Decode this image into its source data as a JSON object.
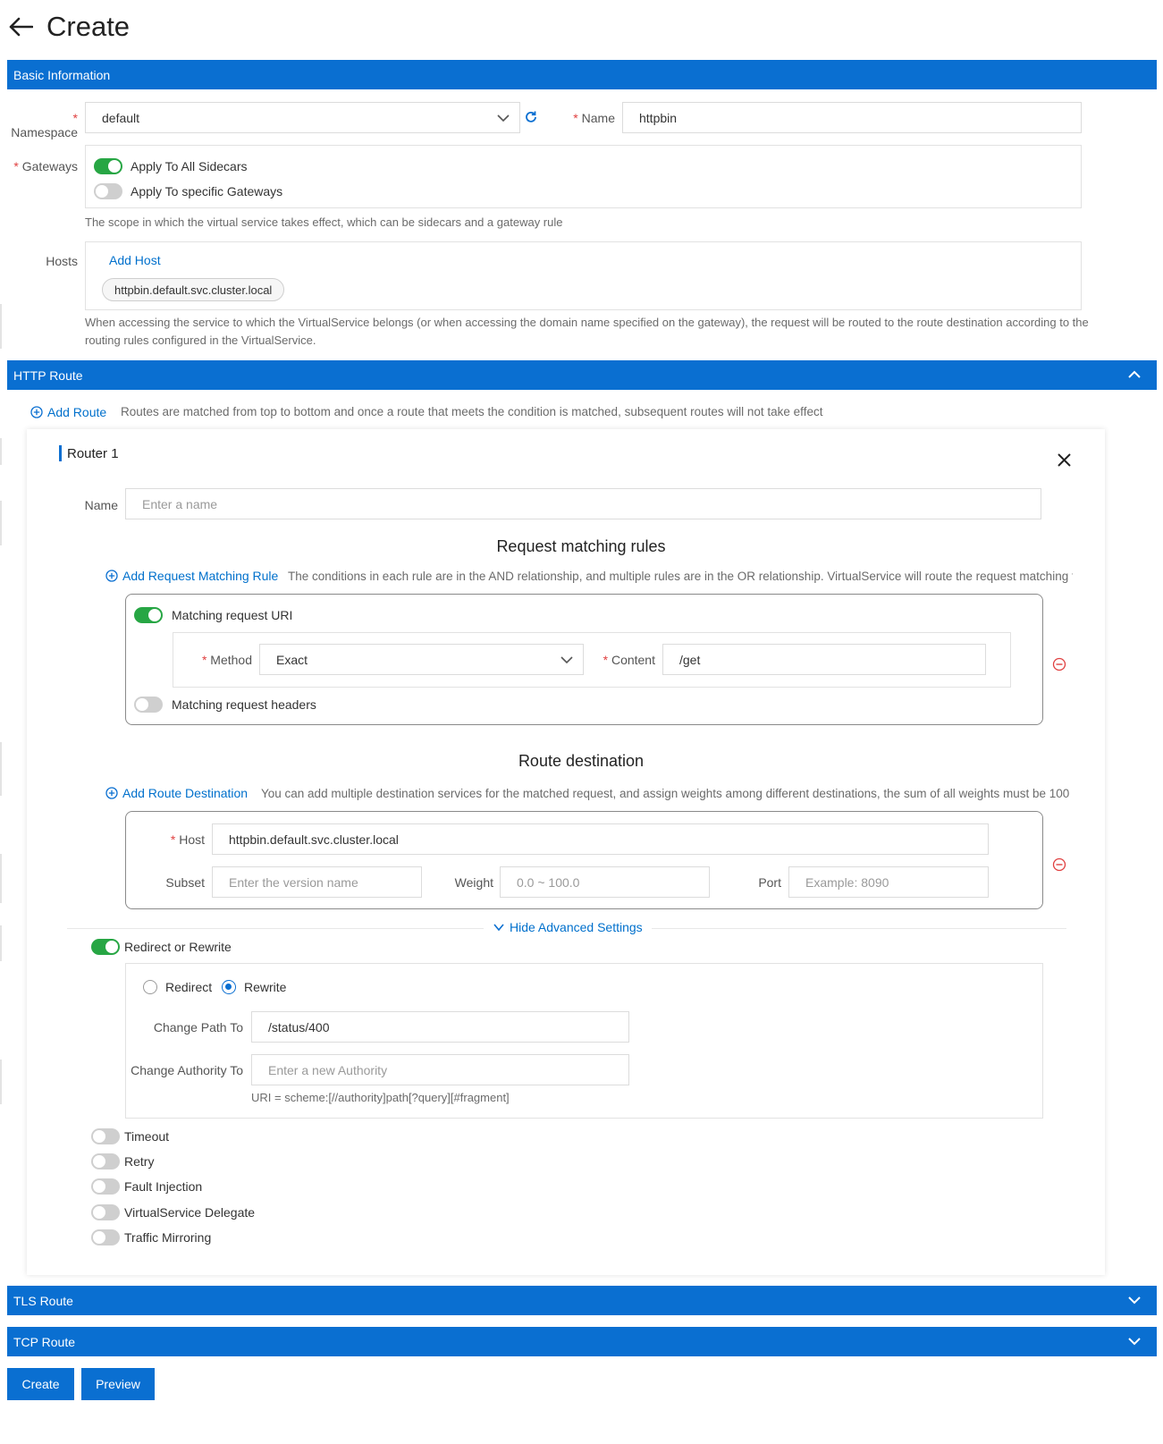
{
  "page": {
    "title": "Create"
  },
  "basic": {
    "section_title": "Basic Information",
    "namespace_label": "Namespace",
    "namespace_value": "default",
    "name_label": "Name",
    "name_value": "httpbin",
    "gateways_label": "Gateways",
    "apply_all_label": "Apply To All Sidecars",
    "apply_all_on": true,
    "apply_specific_label": "Apply To specific Gateways",
    "apply_specific_on": false,
    "gateways_hint": "The scope in which the virtual service takes effect, which can be sidecars and a gateway rule",
    "hosts_label": "Hosts",
    "add_host": "Add Host",
    "host_chip": "httpbin.default.svc.cluster.local",
    "hosts_hint_line1": "When accessing the service to which the VirtualService belongs (or when accessing the domain name specified on the gateway), the request will be routed to the route destination according to the",
    "hosts_hint_line2": "routing rules configured in the VirtualService."
  },
  "http": {
    "section_title": "HTTP Route",
    "add_route": "Add Route",
    "add_route_hint": "Routes are matched from top to bottom and once a route that meets the condition is matched, subsequent routes will not take effect",
    "router": {
      "title": "Router 1",
      "name_label": "Name",
      "name_placeholder": "Enter a name",
      "matching_title": "Request matching rules",
      "add_matching_rule": "Add Request Matching Rule",
      "matching_hint": "The conditions in each rule are in the AND relationship, and multiple rules are in the OR relationship. VirtualService will route the request matching the c",
      "match_uri_label": "Matching request URI",
      "match_uri_on": true,
      "method_label": "Method",
      "method_value": "Exact",
      "content_label": "Content",
      "content_value": "/get",
      "match_headers_label": "Matching request headers",
      "match_headers_on": false,
      "destination_title": "Route destination",
      "add_destination": "Add Route Destination",
      "destination_hint": "You can add multiple destination services for the matched request, and assign weights among different destinations, the sum of all weights must be 100",
      "host_label": "Host",
      "host_value": "httpbin.default.svc.cluster.local",
      "subset_label": "Subset",
      "subset_placeholder": "Enter the version name",
      "weight_label": "Weight",
      "weight_placeholder": "0.0 ~ 100.0",
      "port_label": "Port",
      "port_placeholder": "Example: 8090",
      "hide_advanced": "Hide Advanced Settings",
      "redirect_rewrite_label": "Redirect or Rewrite",
      "redirect_rewrite_on": true,
      "redirect_label": "Redirect",
      "rewrite_label": "Rewrite",
      "selected_mode": "Rewrite",
      "change_path_label": "Change Path To",
      "change_path_value": "/status/400",
      "change_authority_label": "Change Authority To",
      "change_authority_placeholder": "Enter a new Authority",
      "uri_hint": "URI = scheme:[//authority]path[?query][#fragment]",
      "timeout_label": "Timeout",
      "retry_label": "Retry",
      "fault_label": "Fault Injection",
      "delegate_label": "VirtualService Delegate",
      "mirroring_label": "Traffic Mirroring"
    }
  },
  "tls": {
    "section_title": "TLS Route"
  },
  "tcp": {
    "section_title": "TCP Route"
  },
  "footer": {
    "create_label": "Create",
    "preview_label": "Preview"
  },
  "colors": {
    "primary": "#0a6fd1",
    "toggle_on": "#27a644",
    "required": "#e04040",
    "remove": "#e04040"
  }
}
